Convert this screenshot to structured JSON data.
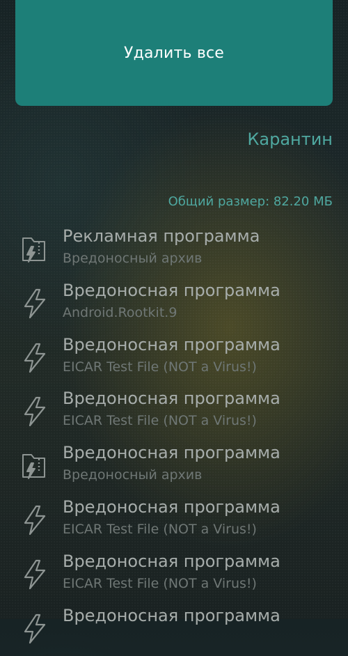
{
  "actions": {
    "delete_all_label": "Удалить все"
  },
  "quarantine": {
    "title": "Карантин",
    "total_size": "Общий размер: 82.20 МБ"
  },
  "threats": [
    {
      "title": "Рекламная программа",
      "subtitle": "Вредоносный архив",
      "icon": "archive-threat-icon"
    },
    {
      "title": "Вредоносная программа",
      "subtitle": "Android.Rootkit.9",
      "icon": "lightning-icon"
    },
    {
      "title": "Вредоносная программа",
      "subtitle": "EICAR Test File (NOT a Virus!)",
      "icon": "lightning-icon"
    },
    {
      "title": "Вредоносная программа",
      "subtitle": "EICAR Test File (NOT a Virus!)",
      "icon": "lightning-icon"
    },
    {
      "title": "Вредоносная программа",
      "subtitle": "Вредоносный архив",
      "icon": "archive-threat-icon"
    },
    {
      "title": "Вредоносная программа",
      "subtitle": "EICAR Test File (NOT a Virus!)",
      "icon": "lightning-icon"
    },
    {
      "title": "Вредоносная программа",
      "subtitle": "EICAR Test File (NOT a Virus!)",
      "icon": "lightning-icon"
    },
    {
      "title": "Вредоносная программа",
      "subtitle": "",
      "icon": "lightning-icon"
    }
  ],
  "colors": {
    "accent": "#1d7f78",
    "accent_text": "#4fa8a0",
    "item_title": "#a7adab",
    "item_subtitle": "#6f7775"
  }
}
